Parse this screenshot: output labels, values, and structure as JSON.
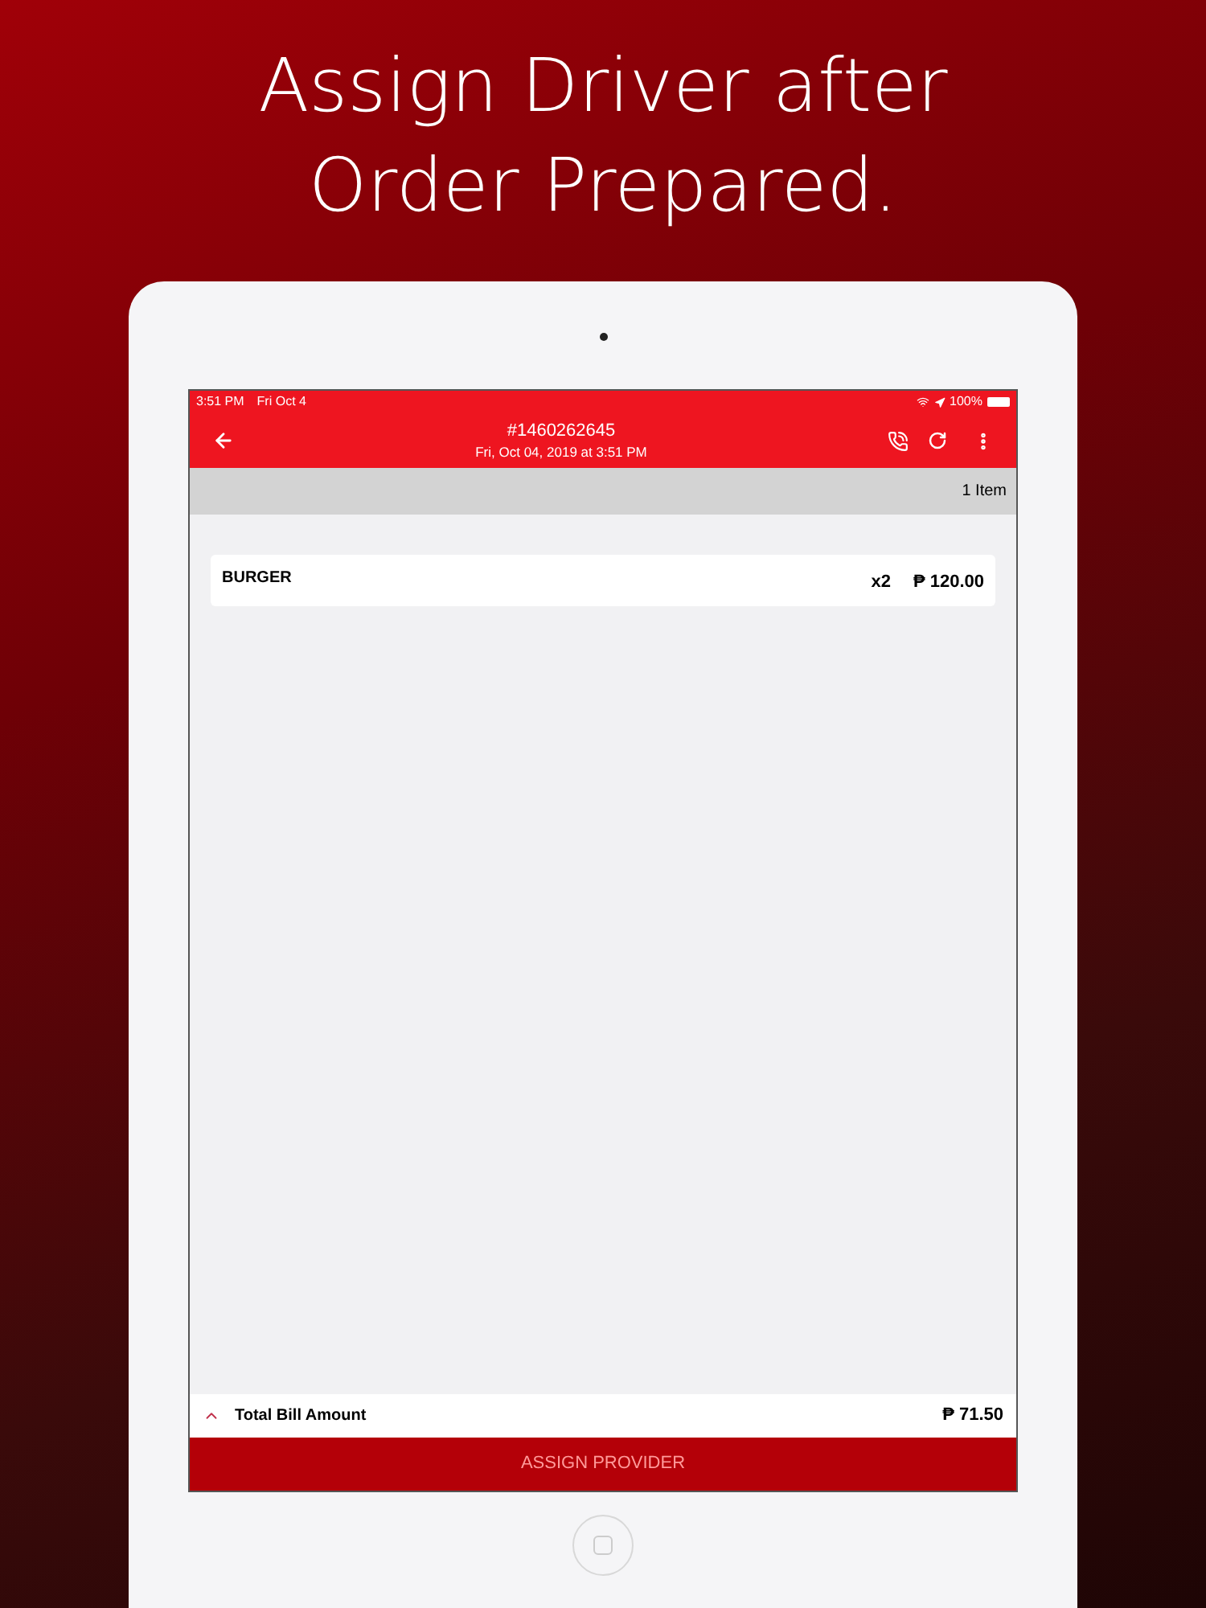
{
  "headline": [
    "Assign Driver after",
    "Order Prepared."
  ],
  "status_bar": {
    "time": "3:51 PM",
    "date": "Fri Oct 4",
    "battery": "100%"
  },
  "header": {
    "order_number": "#1460262645",
    "datetime": "Fri, Oct 04, 2019 at 3:51 PM"
  },
  "item_count": "1 Item",
  "items": [
    {
      "name": "BURGER",
      "quantity": "x2",
      "price": "₱ 120.00"
    }
  ],
  "total": {
    "label": "Total Bill Amount",
    "amount": "₱ 71.50",
    "expanded": false
  },
  "action_button": "ASSIGN PROVIDER"
}
